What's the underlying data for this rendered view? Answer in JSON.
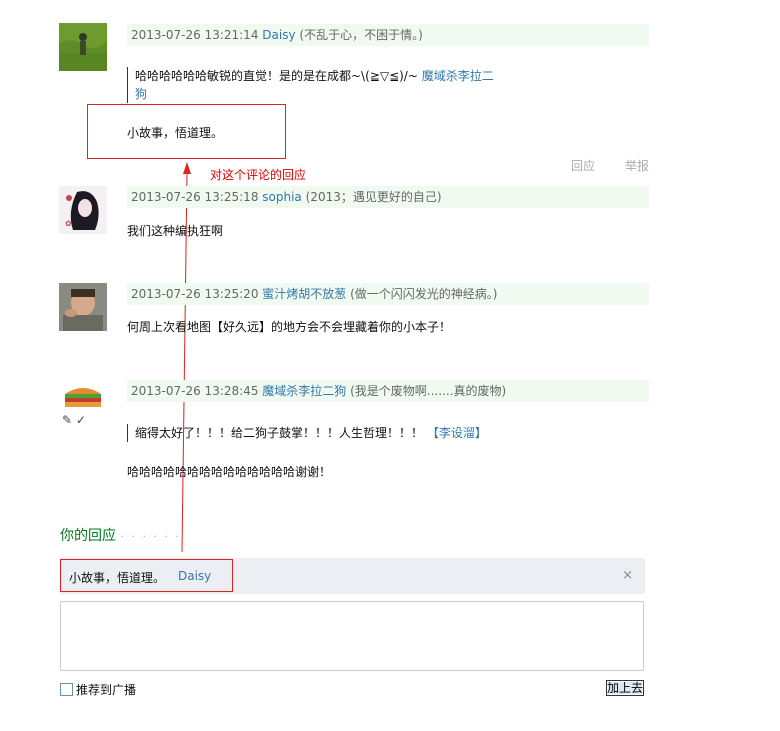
{
  "comments": [
    {
      "timestamp": "2013-07-26 13:21:14",
      "author": "Daisy",
      "signature": "(不乱于心，不困于情。)",
      "quote_text": "哈哈哈哈哈哈敏锐的直觉！是的是在成都~\\(≧▽≦)/~",
      "quote_author_line1": "魔域杀李拉二",
      "quote_author_line2": "狗",
      "body": "小故事，悟道理。"
    },
    {
      "timestamp": "2013-07-26 13:25:18",
      "author": "sophia",
      "signature": "(2013；遇见更好的自己)",
      "body": "我们这种编执狂啊"
    },
    {
      "timestamp": "2013-07-26 13:25:20",
      "author": "蜜汁烤胡不放葱",
      "signature": "(做一个闪闪发光的神经病。)",
      "body": "何周上次看地图【好久远】的地方会不会埋藏着你的小本子！"
    },
    {
      "timestamp": "2013-07-26 13:28:45",
      "author": "魔域杀李拉二狗",
      "signature": "(我是个废物啊.......真的废物)",
      "quote_text": "缩得太好了！！！给二狗子鼓掌！！！人生哲理！！！",
      "quote_author": "【李设溜】",
      "body": "哈哈哈哈哈哈哈哈哈哈哈哈哈哈谢谢！"
    }
  ],
  "actions": {
    "reply": "回应",
    "report": "举报"
  },
  "annotation": "对这个评论的回应",
  "reply_section": {
    "title": "你的回应",
    "dots": "· · · · · ·",
    "quoted_text": "小故事，悟道理。",
    "quoted_author": "Daisy",
    "close": "×",
    "textarea_value": "",
    "recommend_label": "推荐到广播",
    "submit_label": "加上去"
  },
  "colors": {
    "annotation_red": "#dd2222",
    "link": "#3377aa",
    "meta_bg": "#f0faf0",
    "reply_title": "#007722"
  }
}
